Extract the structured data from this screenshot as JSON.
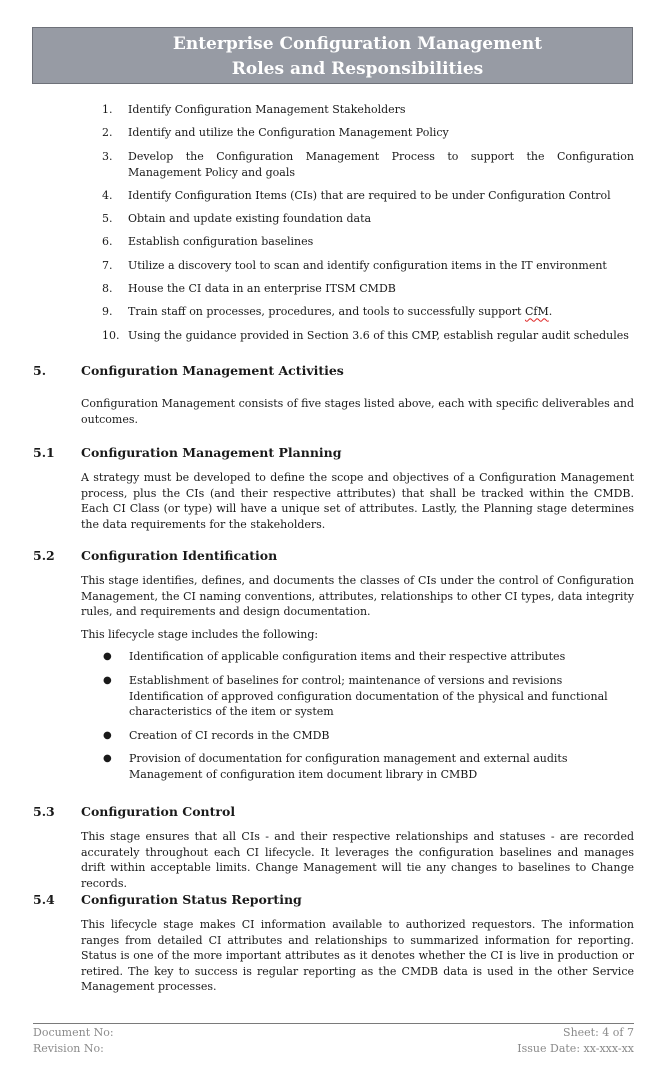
{
  "header": {
    "title_line1": "Enterprise Configuration Management",
    "title_line2": "Roles and Responsibilities"
  },
  "steps": [
    {
      "num": "1.",
      "text": "Identify Configuration Management Stakeholders"
    },
    {
      "num": "2.",
      "text": "Identify and utilize the Configuration Management Policy"
    },
    {
      "num": "3.",
      "text": "Develop the Configuration Management Process to support the Configuration Management Policy and goals"
    },
    {
      "num": "4.",
      "text": "Identify Configuration Items (CIs) that are required to be under Configuration Control"
    },
    {
      "num": "5.",
      "text": "Obtain and update existing foundation data"
    },
    {
      "num": "6.",
      "text": "Establish configuration baselines"
    },
    {
      "num": "7.",
      "text": "Utilize a discovery tool to scan and identify configuration items in the IT environment"
    },
    {
      "num": "8.",
      "text": "House the CI data in an enterprise ITSM CMDB"
    },
    {
      "num": "9.",
      "text": "Train staff on processes, procedures, and tools to successfully support ",
      "flagged_word": "CfM",
      "suffix": "."
    },
    {
      "num": "10.",
      "text": "Using the guidance provided in Section 3.6 of this CMP, establish regular audit schedules"
    }
  ],
  "sections": {
    "s5": {
      "num": "5.",
      "title": "Configuration Management Activities",
      "body": "Configuration Management consists of five stages listed above, each with specific deliverables and outcomes."
    },
    "s5_1": {
      "num": "5.1",
      "title": "Configuration Management Planning",
      "body": "A strategy must be developed to define the scope and objectives of a Configuration Management process, plus the CIs (and their respective attributes) that shall be tracked within the CMDB. Each CI Class (or type) will have a unique set of attributes. Lastly, the Planning stage determines the data requirements for the stakeholders."
    },
    "s5_2": {
      "num": "5.2",
      "title": "Configuration Identification",
      "body": "This stage identifies, defines, and documents the classes of CIs under the control of Configuration Management, the CI naming conventions, attributes, relationships to other CI types, data integrity rules, and requirements and design documentation.",
      "intro": "This lifecycle stage includes the following:",
      "bullets": [
        {
          "line1": "Identification of applicable configuration items and their respective attributes"
        },
        {
          "line1": "Establishment of baselines for control; maintenance of versions and revisions",
          "line2": "Identification of approved configuration documentation of the physical and functional characteristics of the item or system"
        },
        {
          "line1": "Creation of CI records in the CMDB"
        },
        {
          "line1": "Provision of documentation for configuration management and external audits",
          "line2": "Management of configuration item document library in CMBD"
        }
      ]
    },
    "s5_3": {
      "num": "5.3",
      "title": "Configuration Control",
      "body": "This stage ensures that all CIs - and their respective relationships and statuses - are recorded accurately throughout each CI lifecycle. It leverages the configuration baselines and manages drift within acceptable limits. Change Management will tie any changes to baselines to Change records."
    },
    "s5_4": {
      "num": "5.4",
      "title": "Configuration Status Reporting",
      "body": "This lifecycle stage makes CI information available to authorized requestors. The information ranges from detailed CI attributes and relationships to summarized information for reporting. Status is one of the more important attributes as it denotes whether the CI is live in production or retired. The key to success is regular reporting as the CMDB data is used in the other Service Management processes."
    }
  },
  "footer": {
    "document_no": "Document No:",
    "revision_no": "Revision No:",
    "sheet": "Sheet: 4 of 7",
    "issue_date": "Issue Date: xx-xxx-xx"
  },
  "colors": {
    "banner_bg": "#979ba4",
    "banner_text": "#ffffff",
    "footer_text": "#8a8a8a",
    "spellcheck_underline": "#dd2222"
  }
}
